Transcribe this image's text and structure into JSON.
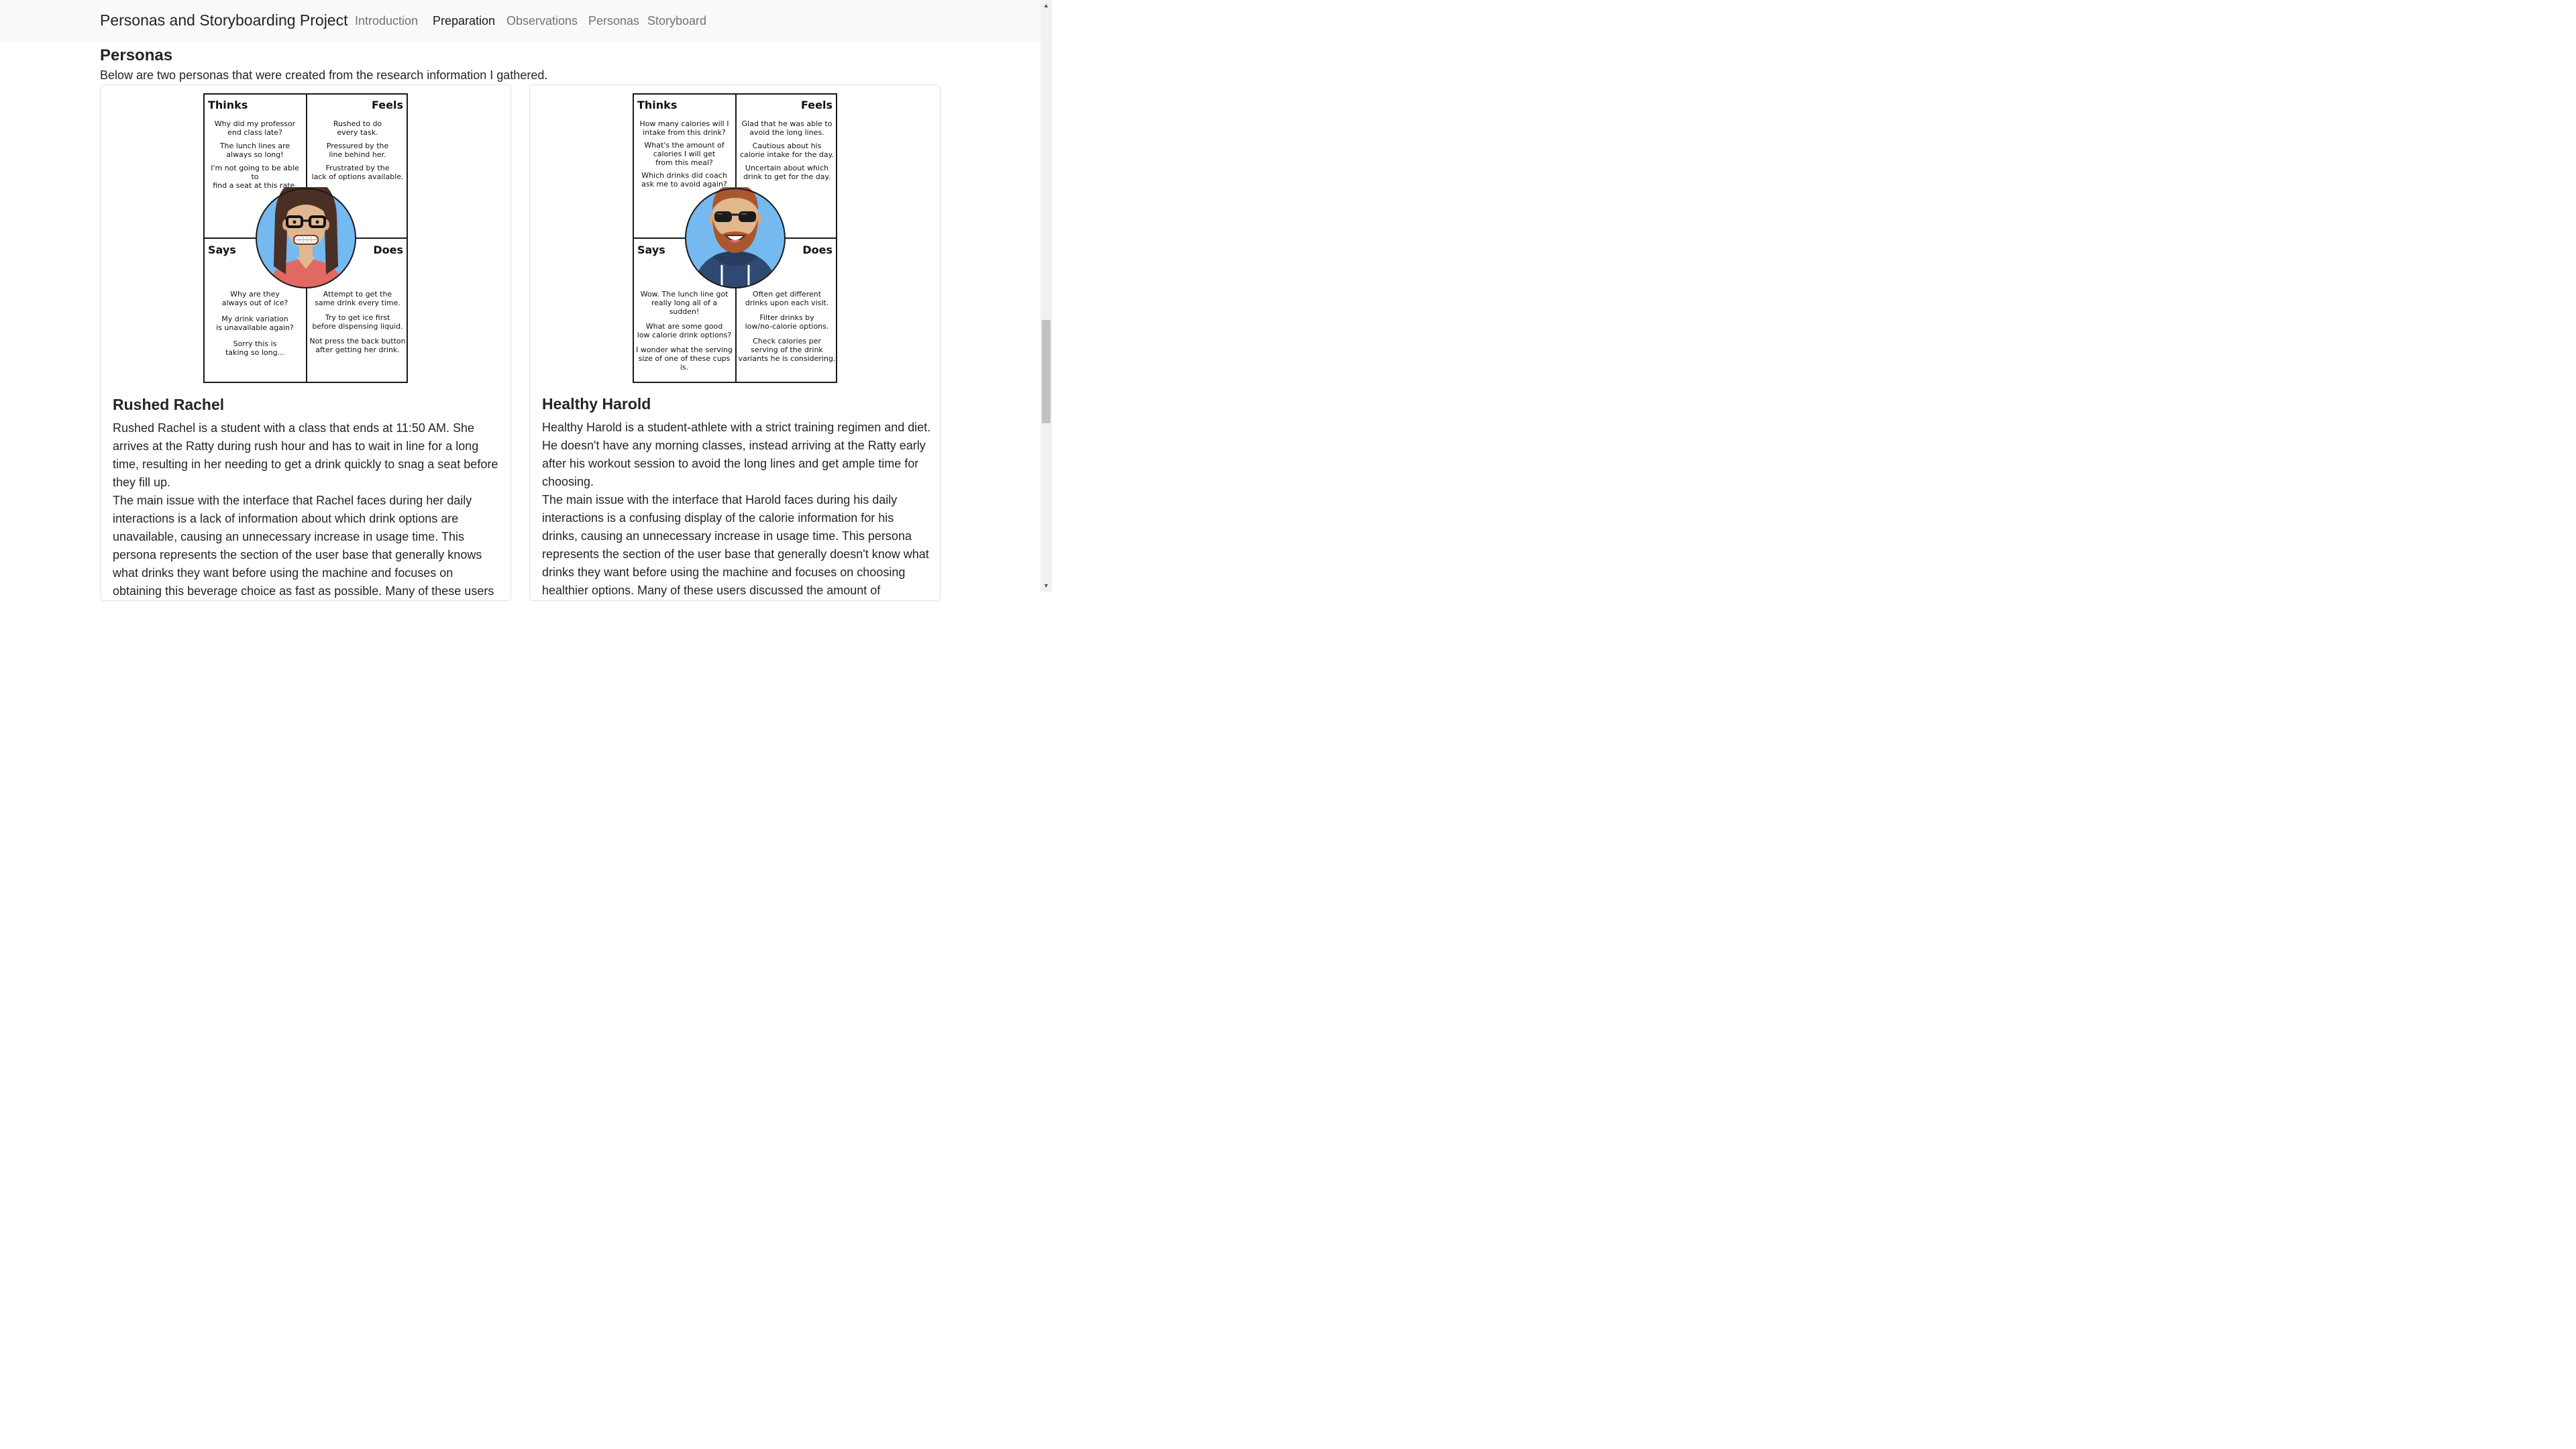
{
  "navbar": {
    "brand": "Personas and Storyboarding Project",
    "links": [
      "Introduction",
      "Preparation",
      "Observations",
      "Personas",
      "Storyboard"
    ],
    "active": "Preparation"
  },
  "section": {
    "title": "Personas",
    "intro": "Below are two personas that were created from the research information I gathered."
  },
  "personas": [
    {
      "name": "Rushed Rachel",
      "map": {
        "thinks_label": "Thinks",
        "feels_label": "Feels",
        "says_label": "Says",
        "does_label": "Does",
        "thinks": [
          "Why did my professor\nend class late?",
          "The lunch lines are\nalways so long!",
          "I'm not going to be able to\nfind a seat at this rate."
        ],
        "feels": [
          "Rushed to do\nevery task.",
          "Pressured by the\nline behind her.",
          "Frustrated by the\nlack of options available."
        ],
        "says": [
          "Why are they\nalways out of ice?",
          "My drink variation\nis unavailable again?",
          "Sorry this is\ntaking so long..."
        ],
        "does": [
          "Attempt to get the\nsame drink every time.",
          "Try to get ice first\nbefore dispensing liquid.",
          "Not press the back button\nafter getting her drink."
        ]
      },
      "paragraphs": [
        "Rushed Rachel is a student with a class that ends at 11:50 AM. She arrives at the Ratty during rush hour and has to wait in line for a long time, resulting in her needing to get a drink quickly to snag a seat before they fill up.",
        "The main issue with the interface that Rachel faces during her daily interactions is a lack of information about which drink options are unavailable, causing an unnecessary increase in usage time. This persona represents the section of the user base that generally knows what drinks they want before using the machine and focuses on obtaining this beverage choice as fast as possible. Many of these users discussed the"
      ]
    },
    {
      "name": "Healthy Harold",
      "map": {
        "thinks_label": "Thinks",
        "feels_label": "Feels",
        "says_label": "Says",
        "does_label": "Does",
        "thinks": [
          "How many calories will I\nintake from this drink?",
          "What's the amount of\ncalories I will get\nfrom this meal?",
          "Which drinks did coach\nask me to avoid again?"
        ],
        "feels": [
          "Glad that he was able to\navoid the long lines.",
          "Cautious about his\ncalorie intake for the day.",
          "Uncertain about which\ndrink to get for the day."
        ],
        "says": [
          "Wow. The lunch line got\nreally long all of a sudden!",
          "What are some good\nlow calorie drink options?",
          "I wonder what the serving\nsize of one of these cups is."
        ],
        "does": [
          "Often get different\ndrinks upon each visit.",
          "Filter drinks by\nlow/no-calorie options.",
          "Check calories per\nserving of the drink\nvariants he is considering."
        ]
      },
      "paragraphs": [
        "Healthy Harold is a student-athlete with a strict training regimen and diet. He doesn't have any morning classes, instead arriving at the Ratty early after his workout session to avoid the long lines and get ample time for choosing.",
        "The main issue with the interface that Harold faces during his daily interactions is a confusing display of the calorie information for his drinks, causing an unnecessary increase in usage time. This persona represents the section of the user base that generally doesn't know what drinks they want before using the machine and focuses on choosing healthier options. Many of these users discussed the amount of"
      ]
    }
  ],
  "colors": {
    "avatar_bg": "#74b9f0",
    "rachel_hair": "#4a2f25",
    "rachel_shirt": "#e06a63",
    "skin": "#e2b78e",
    "harold_hoodie": "#2f4a72",
    "harold_hair": "#a8582c"
  }
}
